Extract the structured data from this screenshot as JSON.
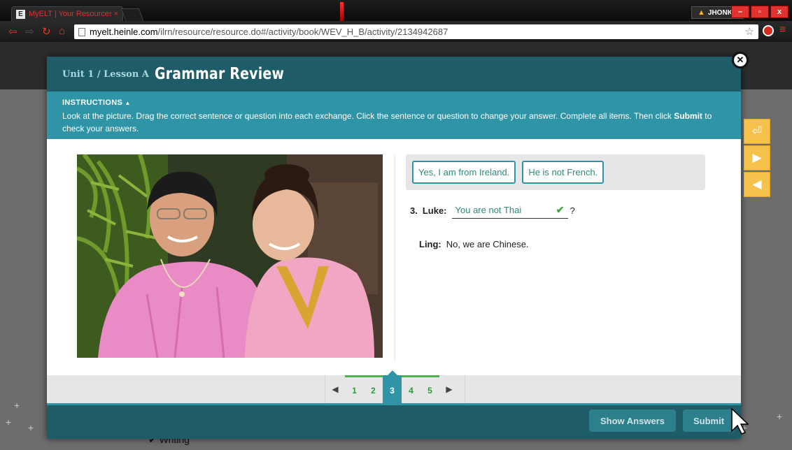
{
  "browser": {
    "tab_favicon": "E",
    "tab_title": "MyELT | Your Resources",
    "tab_close": "×",
    "user": "JHONKA",
    "url_host": "myelt.heinle.com",
    "url_path": "/ilrn/resource/resource.do#/activity/book/WEV_H_B/activity/2134942687",
    "window_buttons": [
      "–",
      "▫",
      "x"
    ]
  },
  "modal": {
    "lesson": "Unit 1 / Lesson A",
    "title": "Grammar Review",
    "instructions_title": "INSTRUCTIONS",
    "instructions_text_1": "Look at the picture. Drag the correct sentence or question into each exchange. Click the sentence or question to change your answer. Complete all items. Then click ",
    "instructions_bold": "Submit",
    "instructions_text_2": " to check your answers.",
    "answer_bank": [
      "Yes, I am from Ireland.",
      "He is not French."
    ],
    "exchange": {
      "number": "3.",
      "speaker1": "Luke:",
      "answer": "You are not Thai",
      "suffix": "?",
      "speaker2": "Ling:",
      "reply": "No, we are Chinese."
    },
    "pages": [
      "1",
      "2",
      "3",
      "4",
      "5"
    ],
    "active_page": "3",
    "show_answers_label": "Show Answers",
    "submit_label": "Submit"
  },
  "background": {
    "writing_label": "Writing"
  },
  "colors": {
    "header": "#1e5c68",
    "instructions": "#2e94a6",
    "answer_text": "#2e8a7a",
    "tool_yellow": "#f6c24b"
  }
}
